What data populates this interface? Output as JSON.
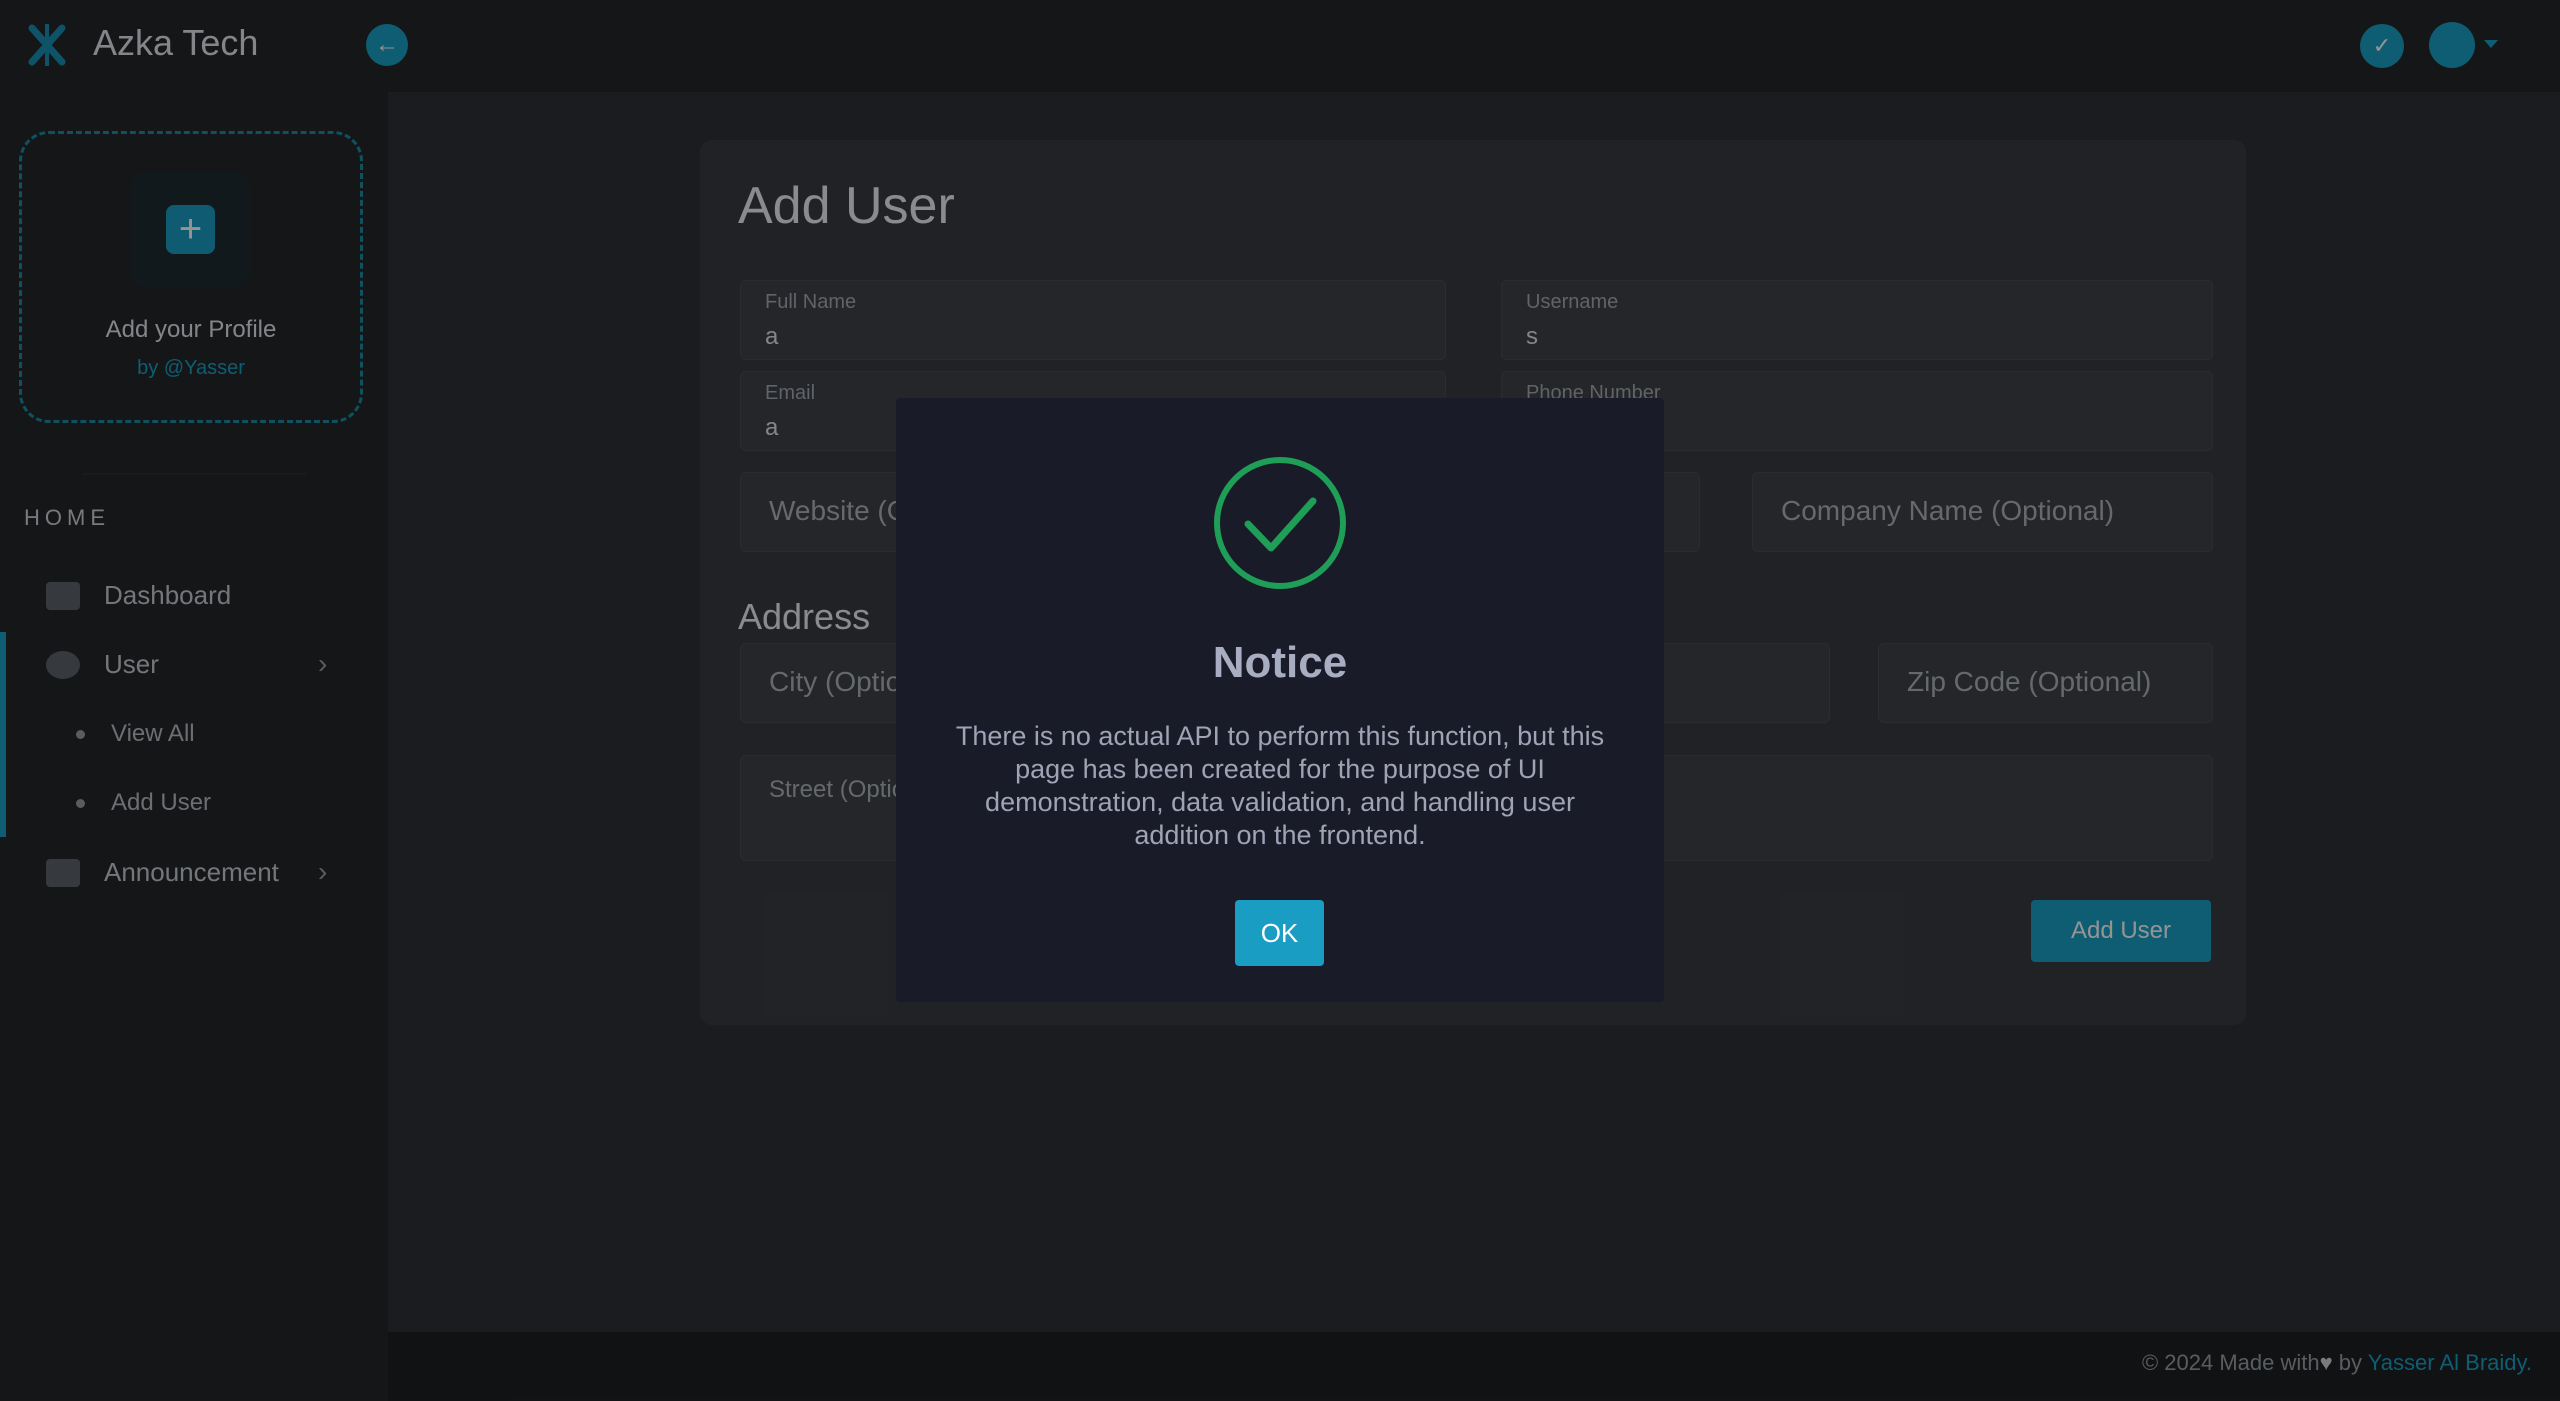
{
  "header": {
    "brand": "Azka Tech"
  },
  "sidebar": {
    "profile_title": "Add your Profile",
    "profile_by": "by @Yasser",
    "section": "HOME",
    "items": [
      {
        "label": "Dashboard"
      },
      {
        "label": "User"
      },
      {
        "label": "View All"
      },
      {
        "label": "Add User"
      },
      {
        "label": "Announcement"
      }
    ]
  },
  "form": {
    "title": "Add User",
    "full_name_label": "Full Name",
    "full_name_value": "a",
    "username_label": "Username",
    "username_value": "s",
    "email_label": "Email",
    "email_value": "a",
    "phone_label": "Phone Number",
    "website_ph": "Website (Optional)",
    "company_ph": "Company Name (Optional)",
    "address_title": "Address",
    "city_ph": "City (Optional)",
    "zip_ph": "Zip Code (Optional)",
    "street_ph": "Street (Optional)",
    "submit_label": "Add User"
  },
  "footer": {
    "text": "© 2024 Made with",
    "heart": "♥",
    "by": " by ",
    "author": "Yasser Al Braidy."
  },
  "modal": {
    "title": "Notice",
    "message": "There is no actual API to perform this function, but this page has been created for the purpose of UI demonstration, data validation, and handling user addition on the frontend.",
    "ok_label": "OK"
  },
  "colors": {
    "accent": "#1aa1c6",
    "success": "#1e9e56",
    "modal_bg": "#191c28"
  }
}
